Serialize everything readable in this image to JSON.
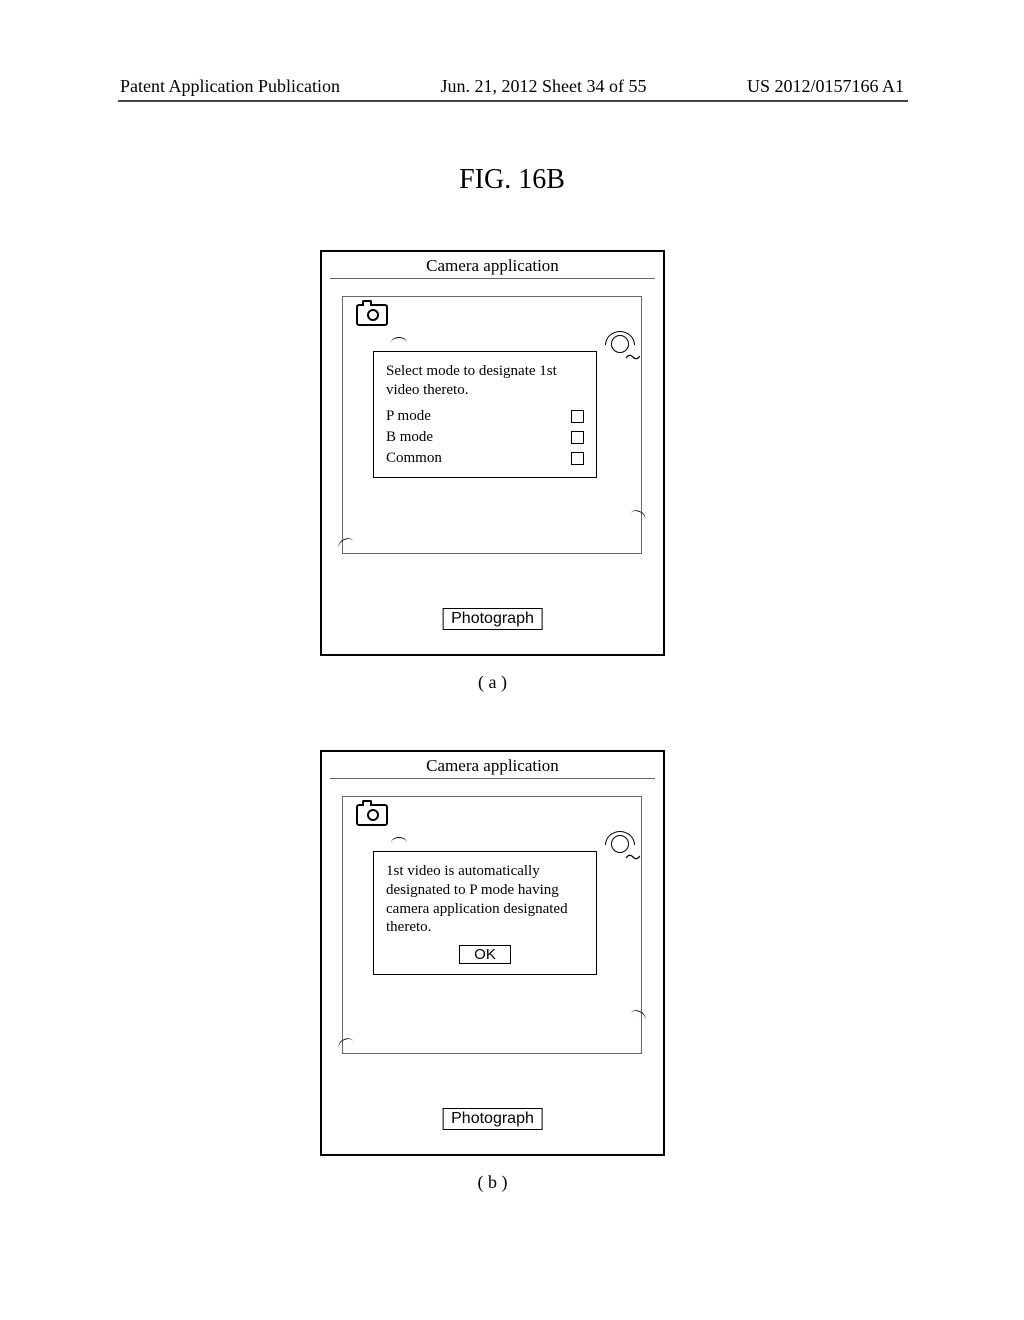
{
  "header": {
    "left": "Patent Application Publication",
    "center": "Jun. 21, 2012  Sheet 34 of 55",
    "right": "US 2012/0157166 A1"
  },
  "figure_title": "FIG. 16B",
  "panel_title": "Camera application",
  "dialog_a": {
    "prompt": "Select mode to designate 1st video thereto.",
    "options": [
      "P mode",
      "B mode",
      "Common"
    ]
  },
  "dialog_b": {
    "message": "1st video is automatically designated to P mode having camera application designated thereto.",
    "ok": "OK"
  },
  "photograph": "Photograph",
  "captions": {
    "a": "( a )",
    "b": "( b )"
  }
}
